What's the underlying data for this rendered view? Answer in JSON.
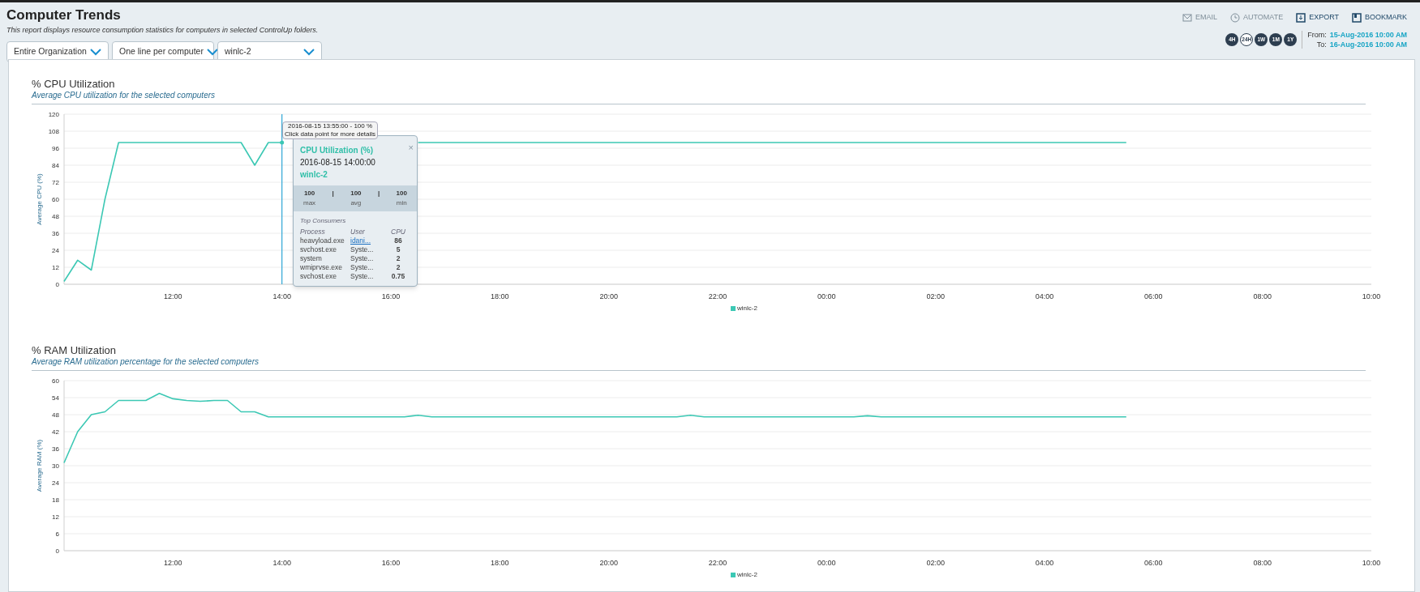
{
  "header": {
    "title": "Computer Trends",
    "subtitle": "This report displays resource consumption statistics for computers in selected ControlUp folders.",
    "filters": [
      {
        "value": "Entire Organization"
      },
      {
        "value": "One line per computer"
      },
      {
        "value": "winlc-2"
      }
    ],
    "actions": [
      {
        "label": "EMAIL",
        "kind": "email",
        "disabled": true
      },
      {
        "label": "AUTOMATE",
        "kind": "clock",
        "disabled": true
      },
      {
        "label": "EXPORT",
        "kind": "export",
        "disabled": false
      },
      {
        "label": "BOOKMARK",
        "kind": "bookmark",
        "disabled": false
      }
    ],
    "ranges": [
      {
        "label": "4H",
        "selected": false
      },
      {
        "label": "24H",
        "selected": true
      },
      {
        "label": "1W",
        "selected": false
      },
      {
        "label": "1M",
        "selected": false
      },
      {
        "label": "1Y",
        "selected": false
      }
    ],
    "from": {
      "label": "From:",
      "value": "15-Aug-2016 10:00 AM"
    },
    "to": {
      "label": "To:",
      "value": "16-Aug-2016 10:00 AM"
    }
  },
  "charts": [
    {
      "title": "% CPU Utilization",
      "subtitle": "Average CPU utilization for the selected computers",
      "chart_data": {
        "type": "line",
        "ylabel": "Average CPU (%)",
        "categories": [
          null,
          null,
          null,
          null,
          null,
          null,
          null,
          null,
          "12:00",
          null,
          null,
          null,
          null,
          null,
          null,
          null,
          "14:00",
          null,
          null,
          null,
          null,
          null,
          null,
          null,
          "16:00",
          null,
          null,
          null,
          null,
          null,
          null,
          null,
          "18:00",
          null,
          null,
          null,
          null,
          null,
          null,
          null,
          "20:00",
          null,
          null,
          null,
          null,
          null,
          null,
          null,
          "22:00",
          null,
          null,
          null,
          null,
          null,
          null,
          null,
          "00:00",
          null,
          null,
          null,
          null,
          null,
          null,
          null,
          "02:00",
          null,
          null,
          null,
          null,
          null,
          null,
          null,
          "04:00",
          null,
          null,
          null,
          null,
          null,
          null,
          null,
          "06:00",
          null,
          null,
          null,
          null,
          null,
          null,
          null,
          "08:00",
          null,
          null,
          null,
          null,
          null,
          null,
          null,
          "10:00"
        ],
        "series": [
          {
            "name": "winlc-2",
            "color": "#3cc8b4",
            "values": [
              2,
              17,
              10,
              60,
              100,
              100,
              100,
              100,
              100,
              100,
              100,
              100,
              100,
              100,
              84,
              100,
              100,
              null,
              null,
              null,
              null,
              null,
              null,
              null,
              null,
              null,
              100,
              100,
              100,
              100,
              100,
              100,
              100,
              100,
              100,
              100,
              100,
              100,
              100,
              100,
              100,
              100,
              100,
              100,
              100,
              100,
              100,
              100,
              100,
              100,
              100,
              100,
              100,
              100,
              100,
              100,
              100,
              100,
              100,
              100,
              100,
              100,
              100,
              100,
              100,
              100,
              100,
              100,
              100,
              100,
              100,
              100,
              100,
              100,
              100,
              100,
              100,
              100,
              100,
              null,
              null,
              null,
              null,
              null,
              null,
              null,
              null,
              null,
              null,
              null,
              null,
              null,
              null,
              null,
              null,
              null,
              null
            ]
          }
        ],
        "ylim": [
          0,
          120
        ],
        "yticks": [
          0,
          12,
          24,
          36,
          48,
          60,
          72,
          84,
          96,
          108,
          120
        ],
        "grid": true,
        "annotations": [
          {
            "x": "14:00"
          }
        ]
      },
      "hover_tooltip": {
        "line_1": "2016-08-15 13:55:00 - 100 %",
        "line_2": "Click data point for more details"
      },
      "details_popup": {
        "close": "×",
        "title": "CPU Utilization (%)",
        "timestamp": "2016-08-15 14:00:00",
        "computer": "winlc-2",
        "stats": [
          {
            "value": "100",
            "label": "max"
          },
          {
            "value": "100",
            "label": "avg"
          },
          {
            "value": "100",
            "label": "min"
          }
        ],
        "separator": "|",
        "section": "Top Consumers",
        "columns": [
          "Process",
          "User",
          "CPU"
        ],
        "rows": [
          {
            "process": "heavyload.exe",
            "user": "idani...",
            "cpu": "86",
            "user_link": true
          },
          {
            "process": "svchost.exe",
            "user": "Syste...",
            "cpu": "5",
            "user_link": false
          },
          {
            "process": "system",
            "user": "Syste...",
            "cpu": "2",
            "user_link": false
          },
          {
            "process": "wmiprvse.exe",
            "user": "Syste...",
            "cpu": "2",
            "user_link": false
          },
          {
            "process": "svchost.exe",
            "user": "Syste...",
            "cpu": "0.75",
            "user_link": false
          }
        ]
      }
    },
    {
      "title": "% RAM Utilization",
      "subtitle": "Average RAM utilization percentage for the selected computers",
      "chart_data": {
        "type": "line",
        "ylabel": "Average RAM (%)",
        "categories": [
          null,
          null,
          null,
          null,
          null,
          null,
          null,
          null,
          "12:00",
          null,
          null,
          null,
          null,
          null,
          null,
          null,
          "14:00",
          null,
          null,
          null,
          null,
          null,
          null,
          null,
          "16:00",
          null,
          null,
          null,
          null,
          null,
          null,
          null,
          "18:00",
          null,
          null,
          null,
          null,
          null,
          null,
          null,
          "20:00",
          null,
          null,
          null,
          null,
          null,
          null,
          null,
          "22:00",
          null,
          null,
          null,
          null,
          null,
          null,
          null,
          "00:00",
          null,
          null,
          null,
          null,
          null,
          null,
          null,
          "02:00",
          null,
          null,
          null,
          null,
          null,
          null,
          null,
          "04:00",
          null,
          null,
          null,
          null,
          null,
          null,
          null,
          "06:00",
          null,
          null,
          null,
          null,
          null,
          null,
          null,
          "08:00",
          null,
          null,
          null,
          null,
          null,
          null,
          null,
          "10:00"
        ],
        "series": [
          {
            "name": "winlc-2",
            "color": "#3cc8b4",
            "values": [
              31,
              42,
              48,
              49,
              53,
              53,
              53,
              55.5,
              53.6,
              53,
              52.7,
              53,
              53,
              49,
              49,
              47.2,
              47.2,
              47.2,
              47.2,
              47.2,
              47.2,
              47.2,
              47.2,
              47.2,
              47.2,
              47.2,
              47.8,
              47.2,
              47.2,
              47.2,
              47.2,
              47.2,
              47.2,
              47.2,
              47.2,
              47.2,
              47.2,
              47.2,
              47.2,
              47.2,
              47.2,
              47.2,
              47.2,
              47.2,
              47.2,
              47.2,
              47.8,
              47.2,
              47.2,
              47.2,
              47.2,
              47.2,
              47.2,
              47.2,
              47.2,
              47.2,
              47.2,
              47.2,
              47.2,
              47.6,
              47.2,
              47.2,
              47.2,
              47.2,
              47.2,
              47.2,
              47.2,
              47.2,
              47.2,
              47.2,
              47.2,
              47.2,
              47.2,
              47.2,
              47.2,
              47.2,
              47.2,
              47.2,
              47.2,
              null,
              null,
              null,
              null,
              null,
              null,
              null,
              null,
              null,
              null,
              null,
              null,
              null,
              null,
              null,
              null,
              null,
              null
            ]
          }
        ],
        "ylim": [
          0,
          60
        ],
        "yticks": [
          0,
          6,
          12,
          18,
          24,
          30,
          36,
          42,
          48,
          54,
          60
        ],
        "grid": true
      }
    }
  ]
}
